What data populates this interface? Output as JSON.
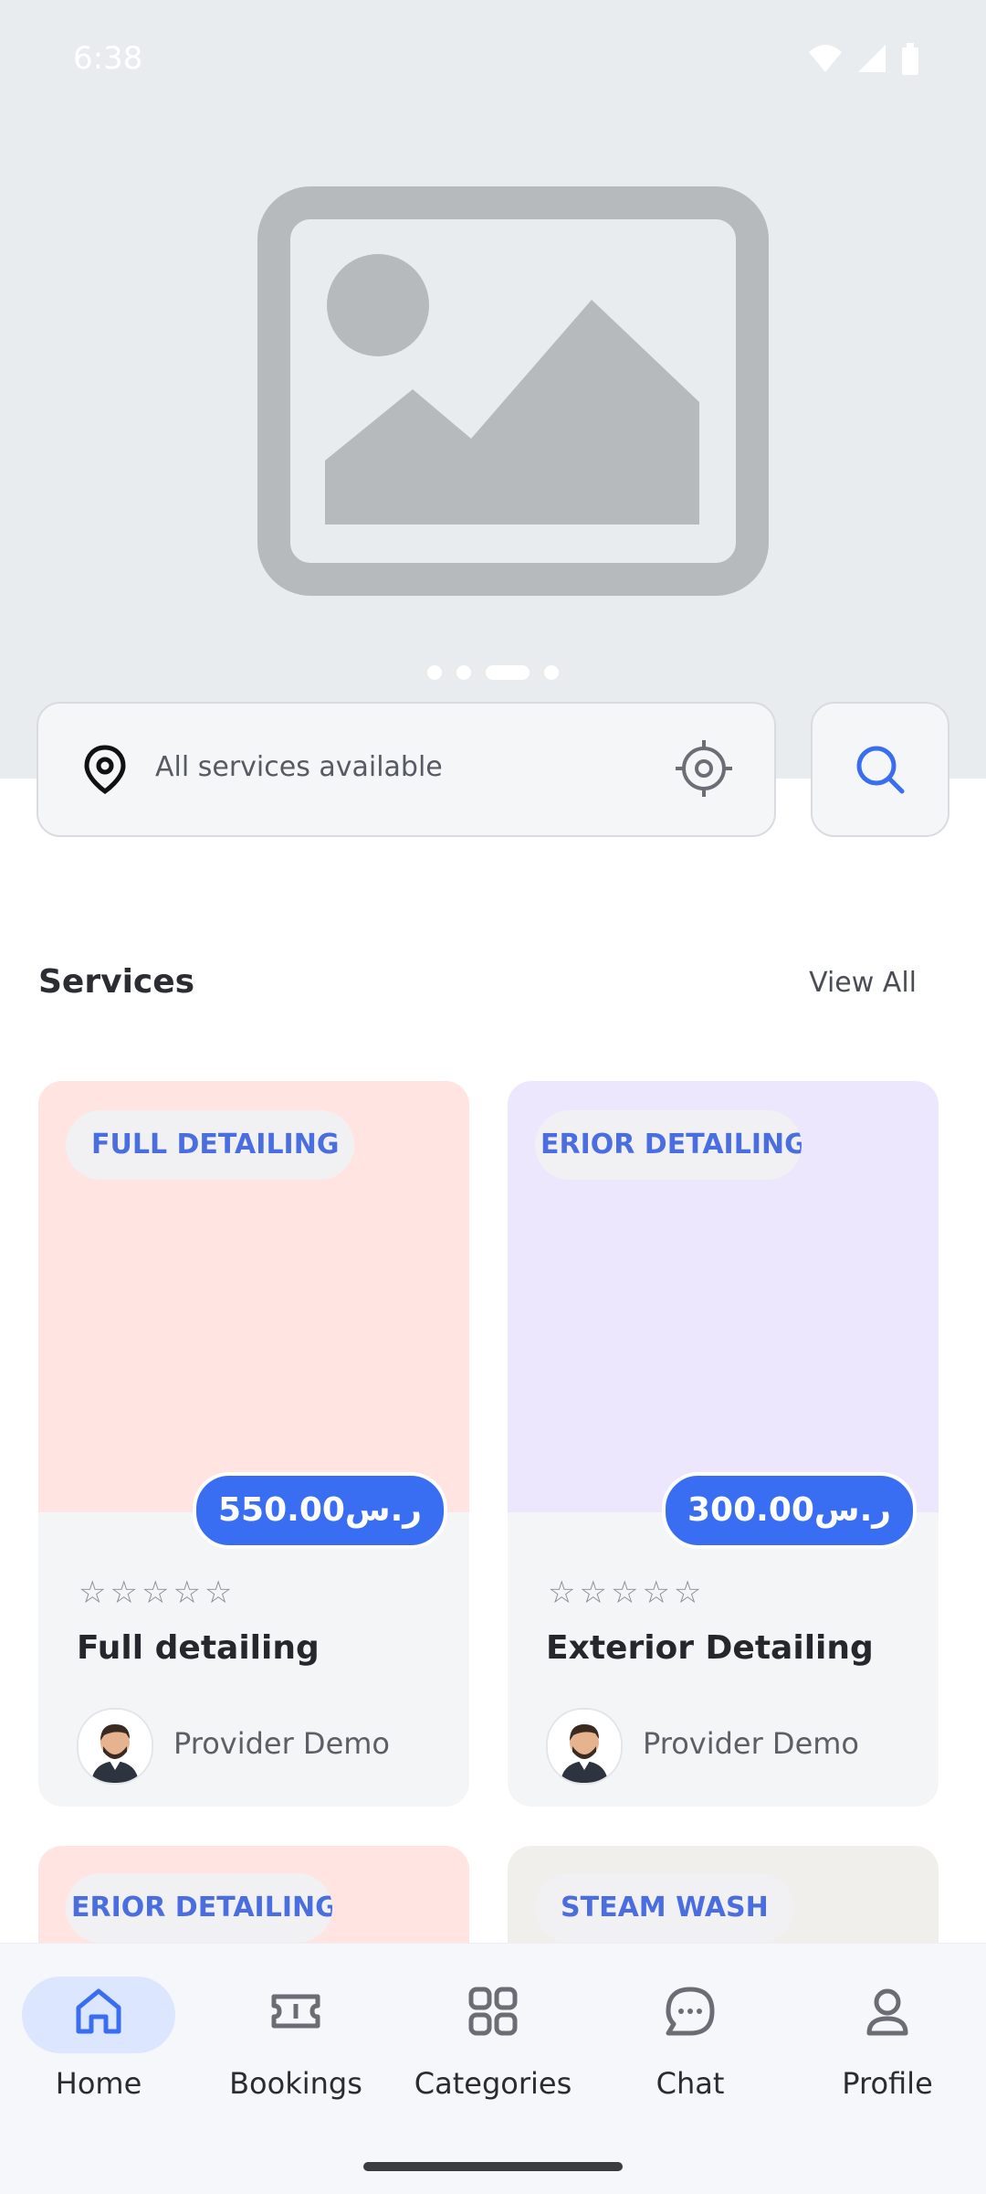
{
  "status_bar": {
    "time": "6:38"
  },
  "search": {
    "placeholder": "All services available"
  },
  "section": {
    "title": "Services",
    "view_all": "View All"
  },
  "cards": [
    {
      "tag": "FULL DETAILING",
      "price": "550.00ر.س",
      "title": "Full detailing",
      "provider": "Provider Demo",
      "stars": "☆☆☆☆☆",
      "color": "#ffe4e1"
    },
    {
      "tag": "ERIOR DETAILING",
      "price": "300.00ر.س",
      "title": "Exterior Detailing",
      "provider": "Provider Demo",
      "stars": "☆☆☆☆☆",
      "color": "#ece7fd"
    },
    {
      "tag": "ERIOR DETAILING",
      "color": "#ffe4e1"
    },
    {
      "tag": "STEAM WASH",
      "color": "#f0efec"
    }
  ],
  "nav": [
    {
      "label": "Home",
      "active": true
    },
    {
      "label": "Bookings"
    },
    {
      "label": "Categories"
    },
    {
      "label": "Chat"
    },
    {
      "label": "Profile"
    }
  ],
  "colors": {
    "accent": "#3a6ef2",
    "tag_text": "#4a6ee0"
  },
  "icons": [
    "image-placeholder-icon",
    "location-pin-icon",
    "crosshair-icon",
    "search-icon",
    "home-icon",
    "ticket-icon",
    "grid-icon",
    "chat-bubble-icon",
    "user-icon"
  ]
}
